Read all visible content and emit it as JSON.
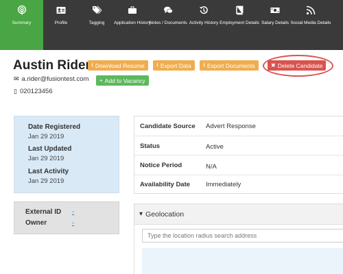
{
  "nav": {
    "items": [
      {
        "label": "Summary",
        "icon": "podcast-icon"
      },
      {
        "label": "Profile",
        "icon": "id-card-icon"
      },
      {
        "label": "Tagging",
        "icon": "tags-icon"
      },
      {
        "label": "Application History",
        "icon": "briefcase-icon"
      },
      {
        "label": "Notes / Documents",
        "icon": "comments-icon"
      },
      {
        "label": "Activity History",
        "icon": "history-icon"
      },
      {
        "label": "Employment Details",
        "icon": "book-icon"
      },
      {
        "label": "Salary Details",
        "icon": "money-icon"
      },
      {
        "label": "Social Media Details",
        "icon": "rss-icon"
      }
    ],
    "active_color": "#4aa545",
    "bg_color": "#3a3a3a"
  },
  "candidate": {
    "name": "Austin Rider",
    "email": "a.rider@fusiontest.com",
    "phone": "020123456"
  },
  "actions": {
    "download_resume": "Download Resume",
    "export_data": "Export Data",
    "export_documents": "Export Documents",
    "delete_candidate": "Delete Candidate",
    "add_to_vacancy": "Add to Vacancy"
  },
  "dates": {
    "registered_label": "Date Registered",
    "registered_value": "Jan 29 2019",
    "updated_label": "Last Updated",
    "updated_value": "Jan 29 2019",
    "activity_label": "Last Activity",
    "activity_value": "Jan 29 2019"
  },
  "external": {
    "id_label": "External ID",
    "id_value": "-",
    "owner_label": "Owner",
    "owner_value": "-"
  },
  "details": [
    {
      "label": "Candidate Source",
      "value": "Advert Response"
    },
    {
      "label": "Status",
      "value": "Active"
    },
    {
      "label": "Notice Period",
      "value": "N/A"
    },
    {
      "label": "Availability Date",
      "value": "Immediately"
    }
  ],
  "geolocation": {
    "title": "Geolocation",
    "placeholder": "Type the location radius search address"
  }
}
